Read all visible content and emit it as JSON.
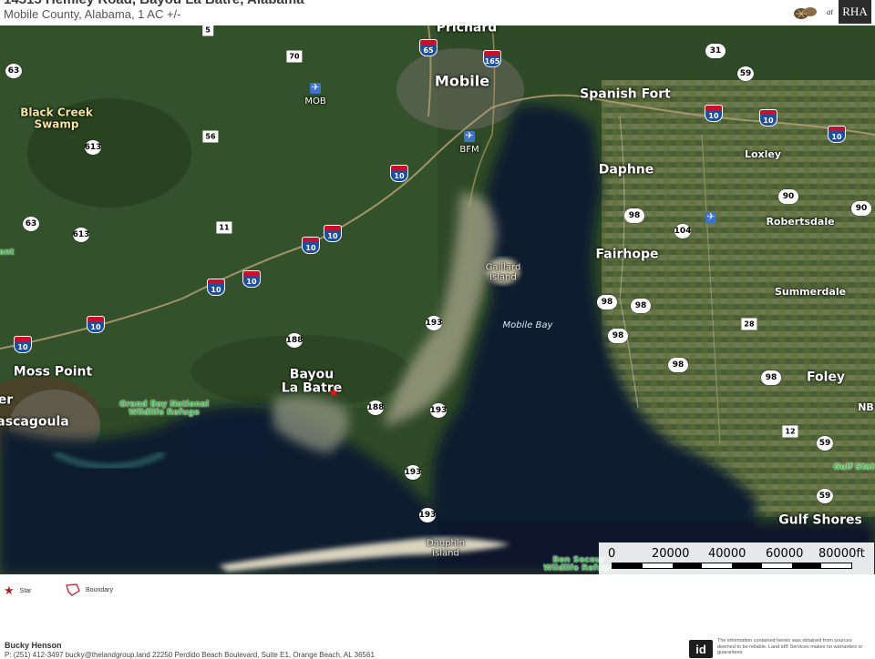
{
  "header": {
    "title": "14515 Hemley Road, Bayou La Batre, Alabama",
    "subtitle": "Mobile County, Alabama, 1 AC +/-",
    "logo_at": "at",
    "logo_rha": "RHA"
  },
  "map": {
    "cities": [
      {
        "name": "Mobile",
        "size": "l"
      },
      {
        "name": "Prichard",
        "size": "m"
      },
      {
        "name": "Spanish Fort",
        "size": "m"
      },
      {
        "name": "Daphne",
        "size": "m"
      },
      {
        "name": "Fairhope",
        "size": "m"
      },
      {
        "name": "Foley",
        "size": "m"
      },
      {
        "name": "Gulf Shores",
        "size": "m"
      },
      {
        "name": "Moss Point",
        "size": "m"
      },
      {
        "name": "Bayou\nLa Batre",
        "size": "m"
      },
      {
        "name": "ascagoula",
        "size": "m"
      },
      {
        "name": "er",
        "size": "m"
      },
      {
        "name": "Loxley",
        "size": "s"
      },
      {
        "name": "Robertsdale",
        "size": "s"
      },
      {
        "name": "Summerdale",
        "size": "s"
      },
      {
        "name": "NB",
        "size": "s"
      }
    ],
    "swamp_label": "Black Creek\nSwamp",
    "green_labels": [
      "Grand Bay National\nWildlife Refuge",
      "Bon Secour\nWildlife Refuge",
      "Gulf Stat",
      "ent"
    ],
    "water_label": "Mobile Bay",
    "islands": [
      "Gaillard\nIsland",
      "Dauphin\nIsland"
    ],
    "airports": [
      "MOB",
      "BFM"
    ],
    "interstate_shields": [
      "10",
      "65",
      "165"
    ],
    "us_route_shields": [
      "90",
      "98",
      "31"
    ],
    "state_route_shields": [
      "5",
      "63",
      "613",
      "70",
      "56",
      "11",
      "188",
      "193",
      "104",
      "59",
      "90",
      "28",
      "12",
      "98"
    ],
    "marker_label": "Star"
  },
  "scale": {
    "labels": [
      "0",
      "20000",
      "40000",
      "60000",
      "80000ft"
    ]
  },
  "legend": {
    "star_label": "Star",
    "boundary_label": "Boundary"
  },
  "footer": {
    "agent_name": "Bucky Henson",
    "contact": "P: (251) 412-3497          bucky@thelandgroup.land          22250 Perdido Beach Boulevard, Suite E1, Orange Beach, AL 36561",
    "id_logo": "id",
    "disclaimer": "The information contained herein was obtained from sources deemed to be reliable. Land id® Services makes no warranties or guarantees"
  },
  "colors": {
    "water": "#0d1a2e",
    "land": "#3c5a30",
    "marker": "#e0141e",
    "interstate_red": "#c8102e",
    "interstate_blue": "#1d4f9c"
  }
}
